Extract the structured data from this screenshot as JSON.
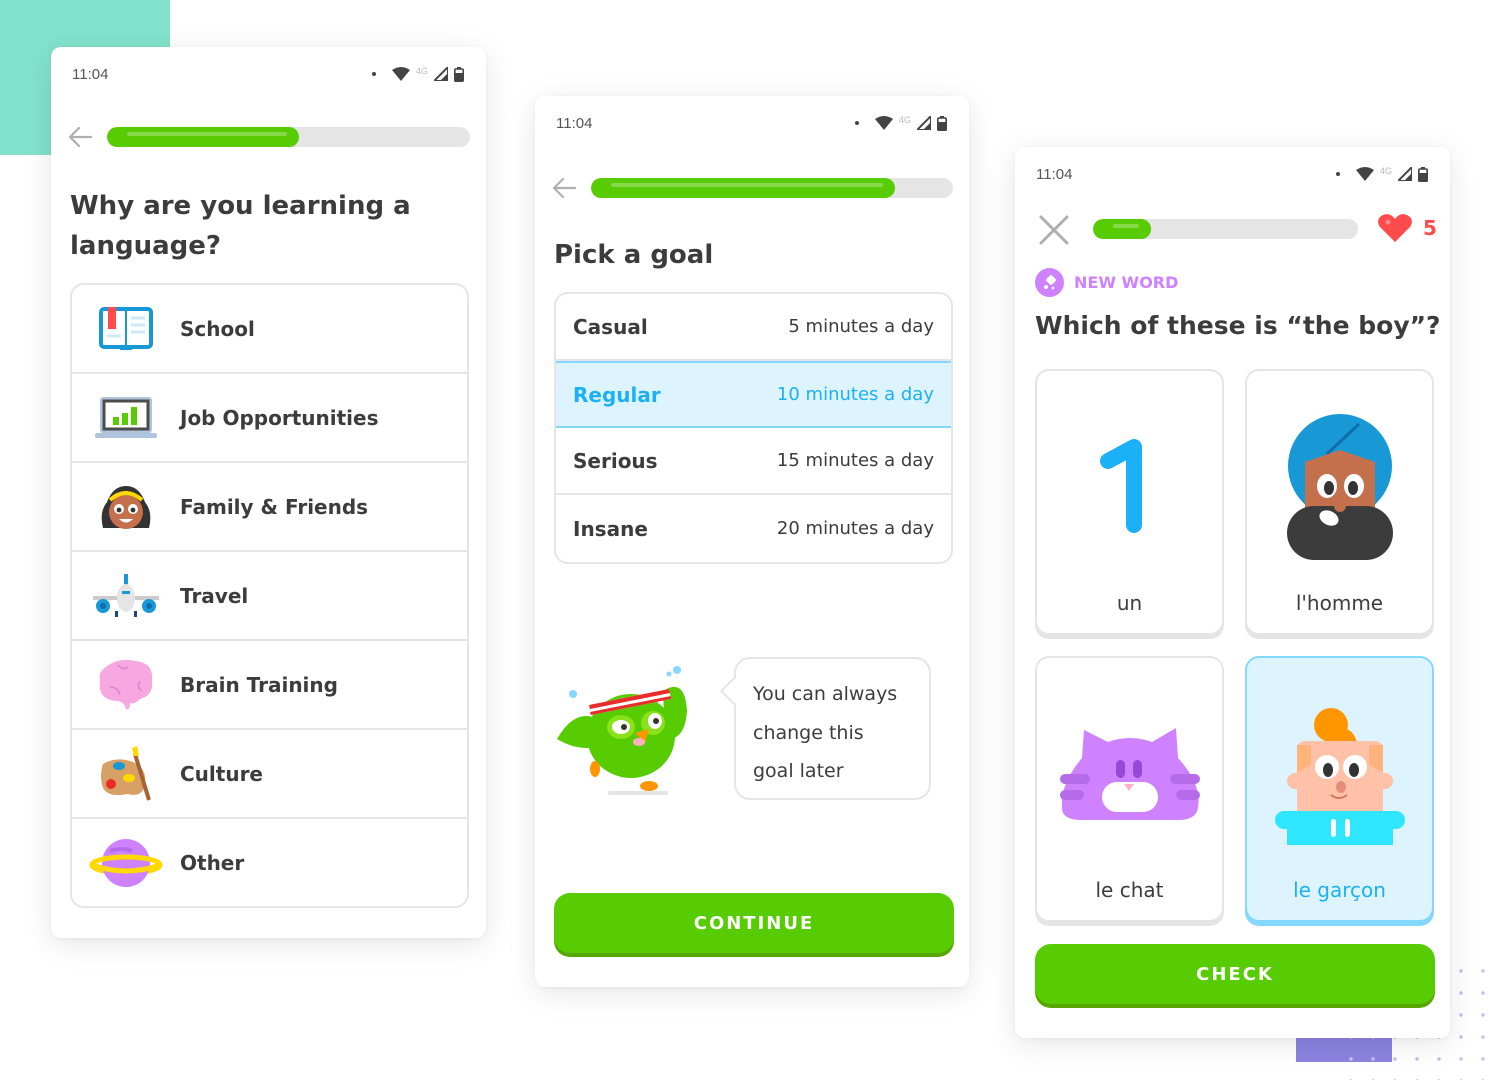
{
  "status_bar": {
    "time": "11:04",
    "network": "4G"
  },
  "screens": [
    {
      "progress": 0.53,
      "title": "Why are you learning a language?",
      "reasons": [
        {
          "label": "School",
          "icon": "book-icon"
        },
        {
          "label": "Job Opportunities",
          "icon": "laptop-chart-icon"
        },
        {
          "label": "Family & Friends",
          "icon": "girl-face-icon"
        },
        {
          "label": "Travel",
          "icon": "airplane-icon"
        },
        {
          "label": "Brain Training",
          "icon": "brain-icon"
        },
        {
          "label": "Culture",
          "icon": "paint-palette-icon"
        },
        {
          "label": "Other",
          "icon": "planet-icon"
        }
      ]
    },
    {
      "progress": 0.84,
      "title": "Pick a goal",
      "goals": [
        {
          "name": "Casual",
          "time": "5 minutes a day",
          "selected": false
        },
        {
          "name": "Regular",
          "time": "10 minutes a day",
          "selected": true
        },
        {
          "name": "Serious",
          "time": "15 minutes a day",
          "selected": false
        },
        {
          "name": "Insane",
          "time": "20 minutes a day",
          "selected": false
        }
      ],
      "bubble_lines": [
        "You can always",
        "change this",
        "goal later"
      ],
      "continue_label": "CONTINUE"
    },
    {
      "progress": 0.22,
      "hearts": "5",
      "badge_label": "NEW WORD",
      "question": "Which of these is “the boy”?",
      "choices": [
        {
          "label": "un",
          "selected": false
        },
        {
          "label": "l'homme",
          "selected": false
        },
        {
          "label": "le chat",
          "selected": false
        },
        {
          "label": "le garçon",
          "selected": true
        }
      ],
      "check_label": "CHECK"
    }
  ],
  "colors": {
    "primary_green": "#58cc02",
    "selected_blue": "#1cb0f6",
    "selected_bg": "#ddf4ff",
    "heart_red": "#ff4b4b",
    "new_word_purple": "#ce82ff"
  }
}
